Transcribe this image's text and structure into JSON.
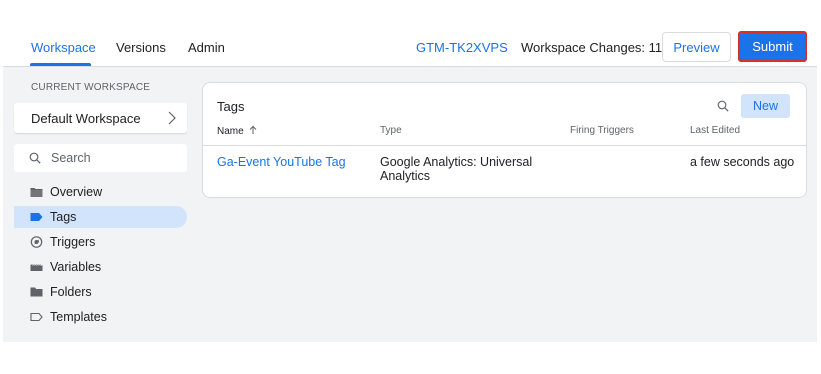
{
  "header": {
    "tabs": [
      {
        "label": "Workspace",
        "active": true
      },
      {
        "label": "Versions",
        "active": false
      },
      {
        "label": "Admin",
        "active": false
      }
    ],
    "container_id": "GTM-TK2XVPS",
    "workspace_changes": "Workspace Changes: 11",
    "preview_label": "Preview",
    "submit_label": "Submit"
  },
  "sidebar": {
    "current_workspace_label": "CURRENT WORKSPACE",
    "workspace_name": "Default Workspace",
    "search_placeholder": "Search",
    "items": [
      {
        "label": "Overview",
        "icon": "overview-icon",
        "active": false
      },
      {
        "label": "Tags",
        "icon": "tag-icon",
        "active": true
      },
      {
        "label": "Triggers",
        "icon": "trigger-icon",
        "active": false
      },
      {
        "label": "Variables",
        "icon": "variables-icon",
        "active": false
      },
      {
        "label": "Folders",
        "icon": "folder-icon",
        "active": false
      },
      {
        "label": "Templates",
        "icon": "template-icon",
        "active": false
      }
    ]
  },
  "tags_panel": {
    "title": "Tags",
    "new_label": "New",
    "columns": [
      "Name",
      "Type",
      "Firing Triggers",
      "Last Edited"
    ],
    "rows": [
      {
        "name": "Ga-Event YouTube Tag",
        "type": "Google Analytics: Universal Analytics",
        "firing_triggers": "",
        "last_edited": "a few seconds ago"
      }
    ]
  },
  "colors": {
    "accent": "#1a73e8",
    "active_nav_bg": "#d2e3fc",
    "submit_outline": "#d93025",
    "background_grey": "#f1f3f4"
  }
}
